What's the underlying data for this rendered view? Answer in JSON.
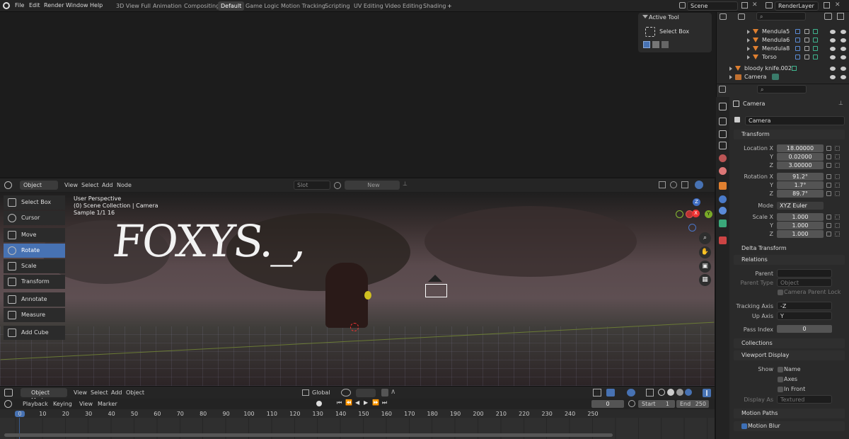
{
  "menu": [
    "File",
    "Edit",
    "Render",
    "Window",
    "Help"
  ],
  "workspaces": [
    {
      "label": "3D View Full",
      "active": false
    },
    {
      "label": "Animation",
      "active": false
    },
    {
      "label": "Compositing",
      "active": false
    },
    {
      "label": "Default",
      "active": true
    },
    {
      "label": "Game Logic",
      "active": false
    },
    {
      "label": "Motion Tracking",
      "active": false
    },
    {
      "label": "Scripting",
      "active": false
    },
    {
      "label": "UV Editing",
      "active": false
    },
    {
      "label": "Video Editing",
      "active": false
    },
    {
      "label": "Shading",
      "active": false
    }
  ],
  "add_workspace": "+",
  "scene": {
    "label": "Scene"
  },
  "view_layer": {
    "label": "RenderLayer"
  },
  "active_tool": {
    "header": "Active Tool",
    "tool": "Select Box"
  },
  "outliner": {
    "rows": [
      {
        "name": "Mendula5",
        "indent": 2
      },
      {
        "name": "Mendula6",
        "indent": 2
      },
      {
        "name": "Mendula8",
        "indent": 2
      },
      {
        "name": "Torso",
        "indent": 2
      },
      {
        "name": "bloody knife.002",
        "indent": 1
      },
      {
        "name": "Camera",
        "indent": 1
      }
    ]
  },
  "node_header": {
    "mode": "Object",
    "menus": [
      "View",
      "Select",
      "Add",
      "Node"
    ],
    "slot": "Slot",
    "new_btn": "New"
  },
  "viewport": {
    "overlay_lines": [
      "User Perspective",
      "(0) Scene Collection | Camera",
      "Sample 1/1 16"
    ],
    "watermark": "FOXYS._,"
  },
  "toolbar": [
    {
      "label": "Select Box",
      "active": false,
      "group": 0
    },
    {
      "label": "Cursor",
      "active": false,
      "group": 0
    },
    {
      "label": "Move",
      "active": false,
      "group": 1
    },
    {
      "label": "Rotate",
      "active": true,
      "group": 1
    },
    {
      "label": "Scale",
      "active": false,
      "group": 1
    },
    {
      "label": "Transform",
      "active": false,
      "group": 2
    },
    {
      "label": "Annotate",
      "active": false,
      "group": 3
    },
    {
      "label": "Measure",
      "active": false,
      "group": 3
    },
    {
      "label": "Add Cube",
      "active": false,
      "group": 4
    }
  ],
  "gizmo": {
    "x": "X",
    "y": "Y",
    "z": "Z"
  },
  "view3d_header": {
    "mode": "Object Mode",
    "menus": [
      "View",
      "Select",
      "Add",
      "Object"
    ],
    "orientation": "Global"
  },
  "timeline": {
    "menus": [
      "Playback",
      "Keying",
      "View",
      "Marker"
    ],
    "current_frame": "0",
    "start_label": "Start",
    "start": "1",
    "end_label": "End",
    "end": "250",
    "ticks": [
      "0",
      "10",
      "20",
      "30",
      "40",
      "50",
      "60",
      "70",
      "80",
      "90",
      "100",
      "110",
      "120",
      "130",
      "140",
      "150",
      "160",
      "170",
      "180",
      "190",
      "200",
      "210",
      "220",
      "230",
      "240",
      "250"
    ]
  },
  "properties": {
    "object_name": "Camera",
    "data_name": "Camera",
    "transform_header": "Transform",
    "location": {
      "label": "Location X",
      "x": "18.00000",
      "y": "0.02000",
      "z": "3.00000"
    },
    "rotation": {
      "label": "Rotation X",
      "x": "91.2°",
      "y": "1.7°",
      "z": "89.7°"
    },
    "mode": {
      "label": "Mode",
      "value": "XYZ Euler"
    },
    "scale": {
      "label": "Scale X",
      "x": "1.000",
      "y": "1.000",
      "z": "1.000"
    },
    "axis_y": "Y",
    "axis_z": "Z",
    "delta": "Delta Transform",
    "relations_header": "Relations",
    "parent_label": "Parent",
    "parent_type_label": "Parent Type",
    "parent_type_value": "Object",
    "parent_lock": "Camera Parent Lock",
    "tracking_label": "Tracking Axis",
    "tracking_value": "-Z",
    "up_label": "Up Axis",
    "up_value": "Y",
    "pass_label": "Pass Index",
    "pass_value": "0",
    "collections": "Collections",
    "viewport_display": "Viewport Display",
    "show_label": "Show",
    "show_name": "Name",
    "show_axes": "Axes",
    "show_front": "In Front",
    "display_as_label": "Display As",
    "display_as_value": "Textured",
    "motion_paths": "Motion Paths",
    "motion_blur": "Motion Blur"
  }
}
